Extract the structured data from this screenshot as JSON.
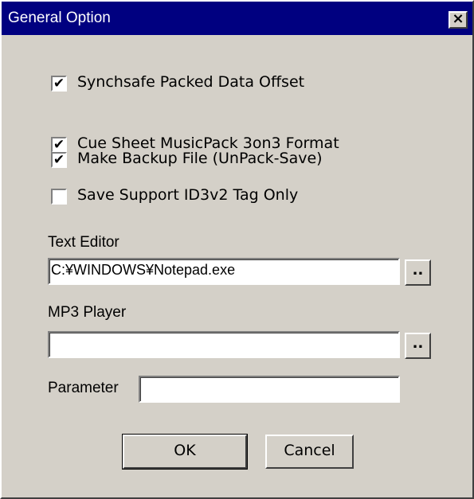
{
  "window": {
    "title": "General Option",
    "close_label": "×"
  },
  "options": [
    {
      "label": "Synchsafe Packed Data Offset",
      "checked": true
    },
    {
      "label": "Cue Sheet MusicPack 3on3 Format",
      "checked": true
    },
    {
      "label": "Make Backup File (UnPack-Save)",
      "checked": true
    },
    {
      "label": "Save Support ID3v2 Tag Only",
      "checked": false
    }
  ],
  "text_editor": {
    "label": "Text Editor",
    "value": "C:¥WINDOWS¥Notepad.exe",
    "browse_label": ".."
  },
  "mp3_player": {
    "label": "MP3 Player",
    "value": "",
    "browse_label": ".."
  },
  "parameter": {
    "label": "Parameter",
    "value": ""
  },
  "buttons": {
    "ok": "OK",
    "cancel": "Cancel"
  },
  "check_mark": "✔"
}
